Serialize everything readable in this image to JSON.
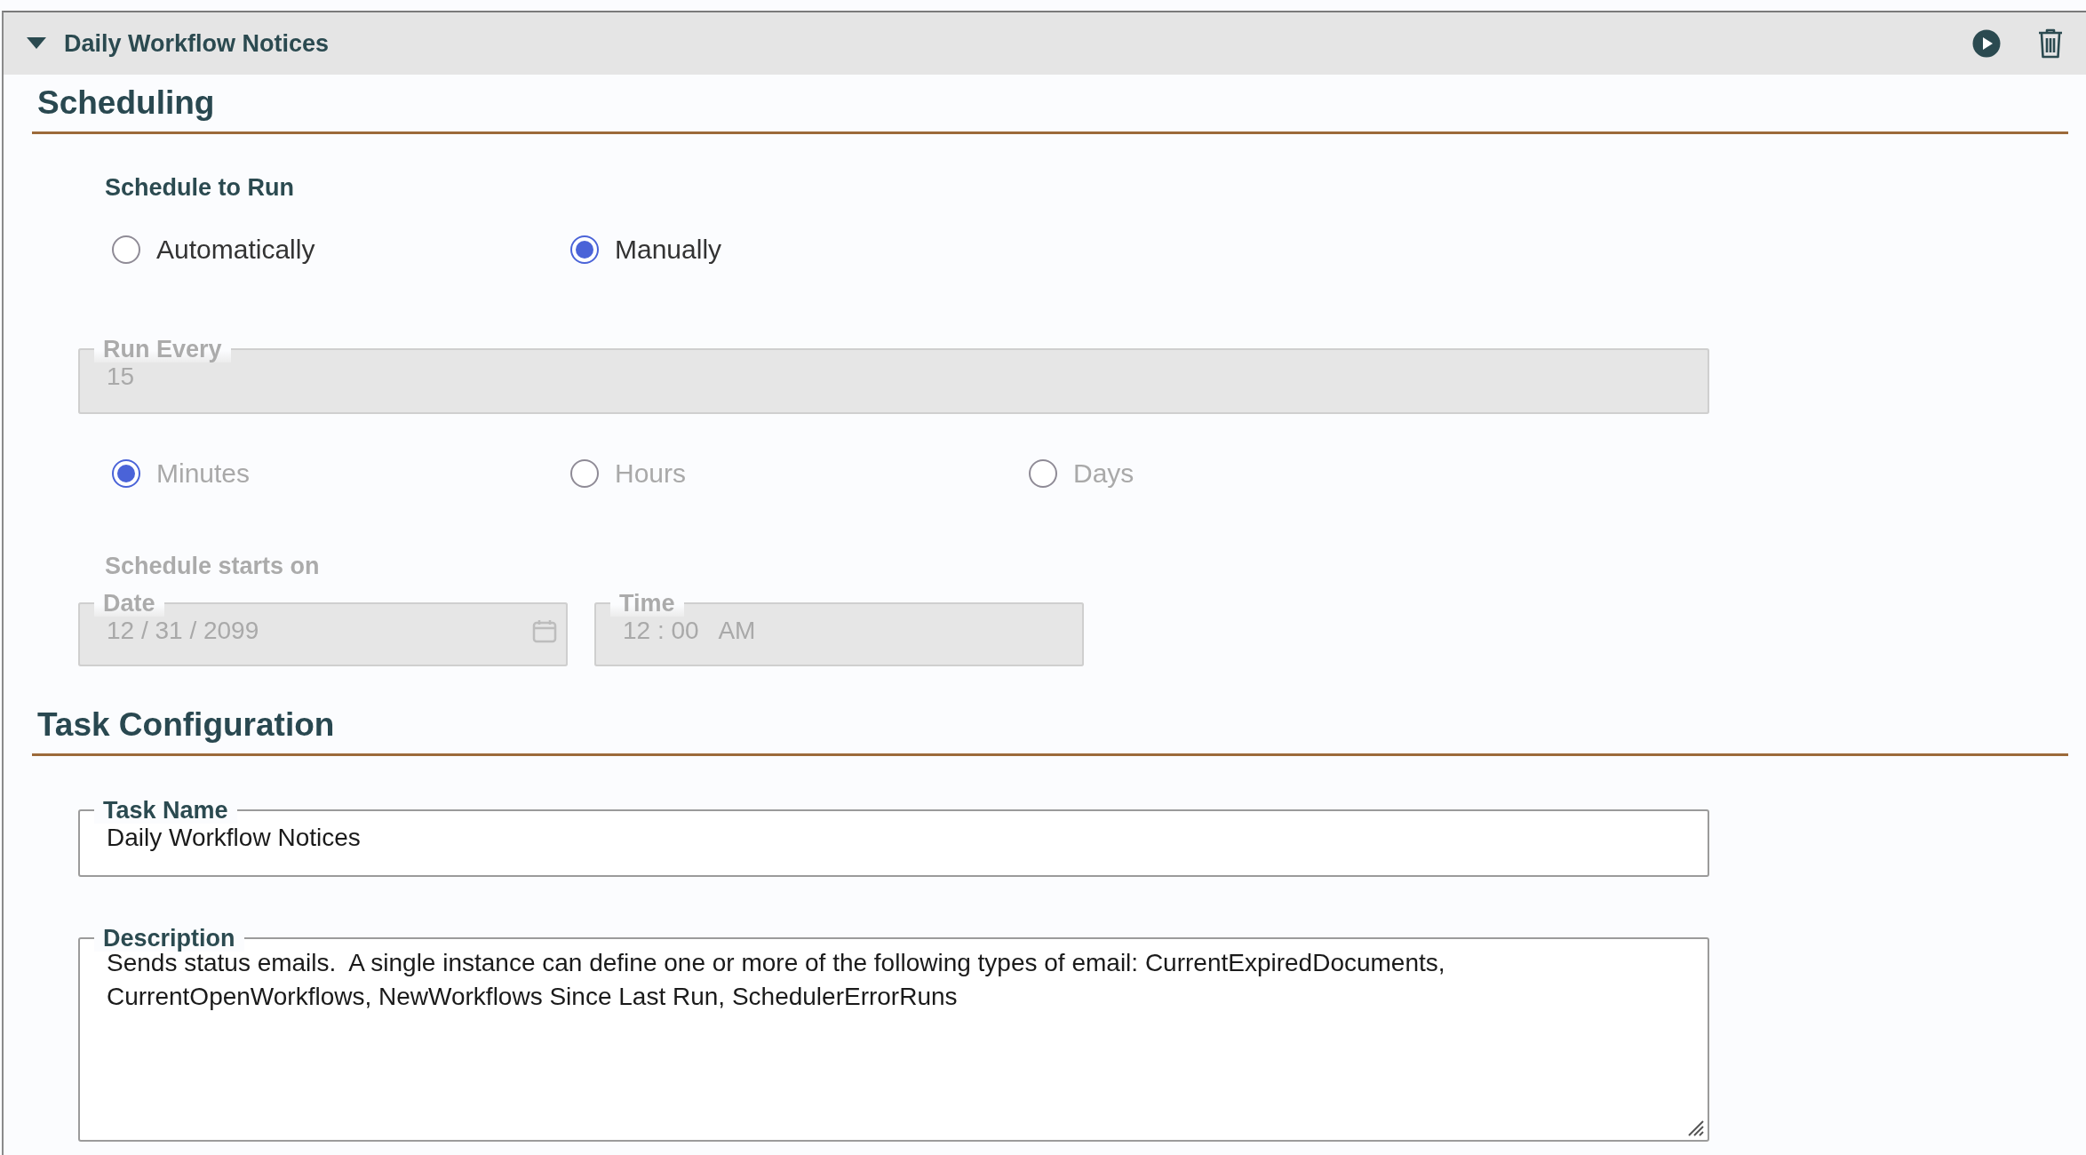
{
  "panel": {
    "title": "Daily Workflow Notices",
    "expanded": true
  },
  "scheduling": {
    "title": "Scheduling",
    "schedule_label": "Schedule to Run",
    "run_options": [
      {
        "label": "Automatically",
        "selected": false
      },
      {
        "label": "Manually",
        "selected": true
      }
    ],
    "interval": {
      "disabled": true,
      "run_every": {
        "label": "Run Every",
        "value": "15"
      },
      "units": [
        {
          "label": "Minutes",
          "selected": true
        },
        {
          "label": "Hours",
          "selected": false
        },
        {
          "label": "Days",
          "selected": false
        }
      ],
      "starts_label": "Schedule starts on",
      "date": {
        "label": "Date",
        "value": "12 / 31 / 2099"
      },
      "time": {
        "label": "Time",
        "value": "12 : 00   AM"
      }
    }
  },
  "task_configuration": {
    "title": "Task Configuration",
    "task_name": {
      "label": "Task Name",
      "value": "Daily Workflow Notices"
    },
    "description": {
      "label": "Description",
      "value": "Sends status emails.  A single instance can define one or more of the following types of email: CurrentExpiredDocuments, CurrentOpenWorkflows, NewWorkflows Since Last Run, SchedulerErrorRuns"
    }
  }
}
